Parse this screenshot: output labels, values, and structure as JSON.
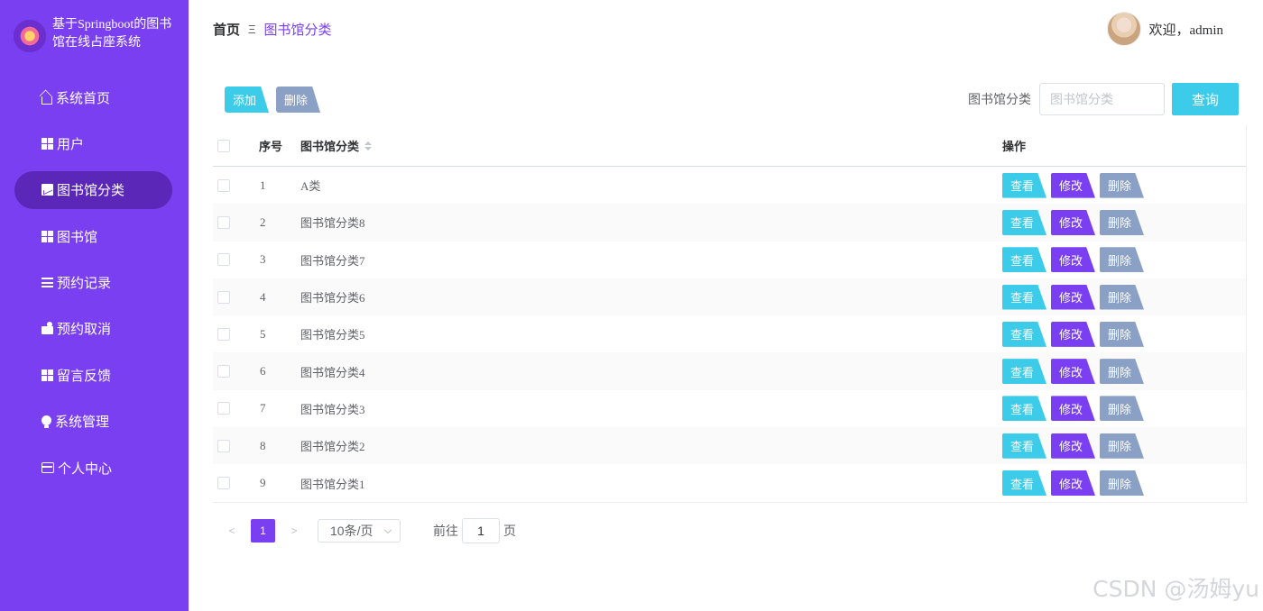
{
  "sidebar": {
    "brand_title": "基于Springboot的图书馆在线占座系统",
    "items": [
      {
        "label": "系统首页",
        "icon": "home-icon"
      },
      {
        "label": "用户",
        "icon": "grid-icon"
      },
      {
        "label": "图书馆分类",
        "icon": "chart-icon",
        "active": true
      },
      {
        "label": "图书馆",
        "icon": "grid-icon"
      },
      {
        "label": "预约记录",
        "icon": "list-icon"
      },
      {
        "label": "预约取消",
        "icon": "cancel-icon"
      },
      {
        "label": "留言反馈",
        "icon": "grid-icon"
      },
      {
        "label": "系统管理",
        "icon": "bulb-icon"
      },
      {
        "label": "个人中心",
        "icon": "card-icon"
      }
    ]
  },
  "header": {
    "breadcrumb_home": "首页",
    "breadcrumb_sep": "Ξ",
    "breadcrumb_current": "图书馆分类",
    "welcome": "欢迎，admin"
  },
  "toolbar": {
    "add_label": "添加",
    "delete_label": "删除"
  },
  "search": {
    "label": "图书馆分类",
    "placeholder": "图书馆分类",
    "button_label": "查询"
  },
  "table": {
    "headers": {
      "index": "序号",
      "name": "图书馆分类",
      "ops": "操作"
    },
    "rows": [
      {
        "index": "1",
        "name": "A类"
      },
      {
        "index": "2",
        "name": "图书馆分类8"
      },
      {
        "index": "3",
        "name": "图书馆分类7"
      },
      {
        "index": "4",
        "name": "图书馆分类6"
      },
      {
        "index": "5",
        "name": "图书馆分类5"
      },
      {
        "index": "6",
        "name": "图书馆分类4"
      },
      {
        "index": "7",
        "name": "图书馆分类3"
      },
      {
        "index": "8",
        "name": "图书馆分类2"
      },
      {
        "index": "9",
        "name": "图书馆分类1"
      }
    ],
    "op_labels": {
      "view": "查看",
      "edit": "修改",
      "delete": "删除"
    }
  },
  "pagination": {
    "prev": "<",
    "next": ">",
    "current_page": "1",
    "page_size": "10条/页",
    "goto_label": "前往",
    "goto_value": "1",
    "goto_suffix": "页"
  },
  "watermark": "CSDN @汤姆yu",
  "colors": {
    "sidebar_bg": "#7a3ff0",
    "active_item_bg": "#5a27b8",
    "accent_cyan": "#3ccbe8",
    "accent_purple": "#7a3ff0",
    "accent_gray": "#8aa0c5"
  }
}
